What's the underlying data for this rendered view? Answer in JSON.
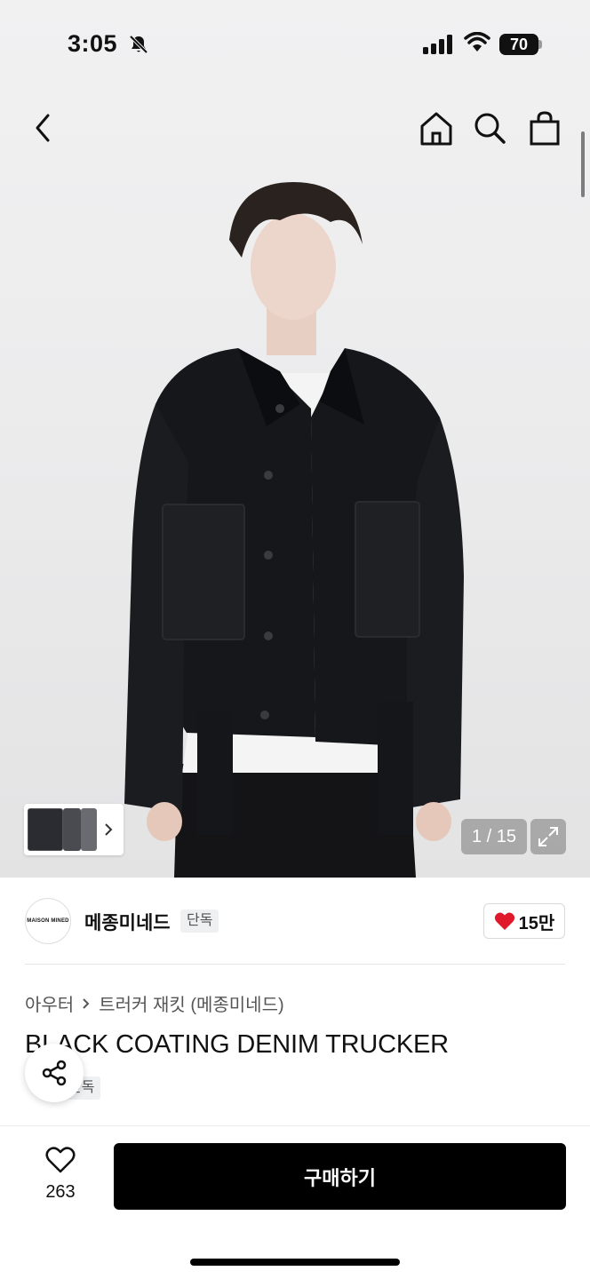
{
  "status_bar": {
    "time": "3:05",
    "battery": "70"
  },
  "gallery": {
    "counter": "1 / 15"
  },
  "brand": {
    "logo_text": "MAISON MINED",
    "name": "메종미네드",
    "badge": "단독",
    "likes": "15만"
  },
  "product": {
    "breadcrumb": [
      "아우터",
      "트러커 재킷 (메종미네드)"
    ],
    "title": "BLACK COATING DENIM TRUCKER",
    "badge": "단독"
  },
  "bottom_bar": {
    "wish_count": "263",
    "buy_label": "구매하기"
  },
  "colors": {
    "accent": "#e0182c",
    "button": "#000000"
  },
  "icons": [
    "back-arrow-icon",
    "home-icon",
    "search-icon",
    "shopping-bag-icon",
    "chevron-right-icon",
    "expand-icon",
    "heart-icon",
    "share-icon",
    "bell-slash-icon",
    "signal-icon",
    "wifi-icon"
  ]
}
